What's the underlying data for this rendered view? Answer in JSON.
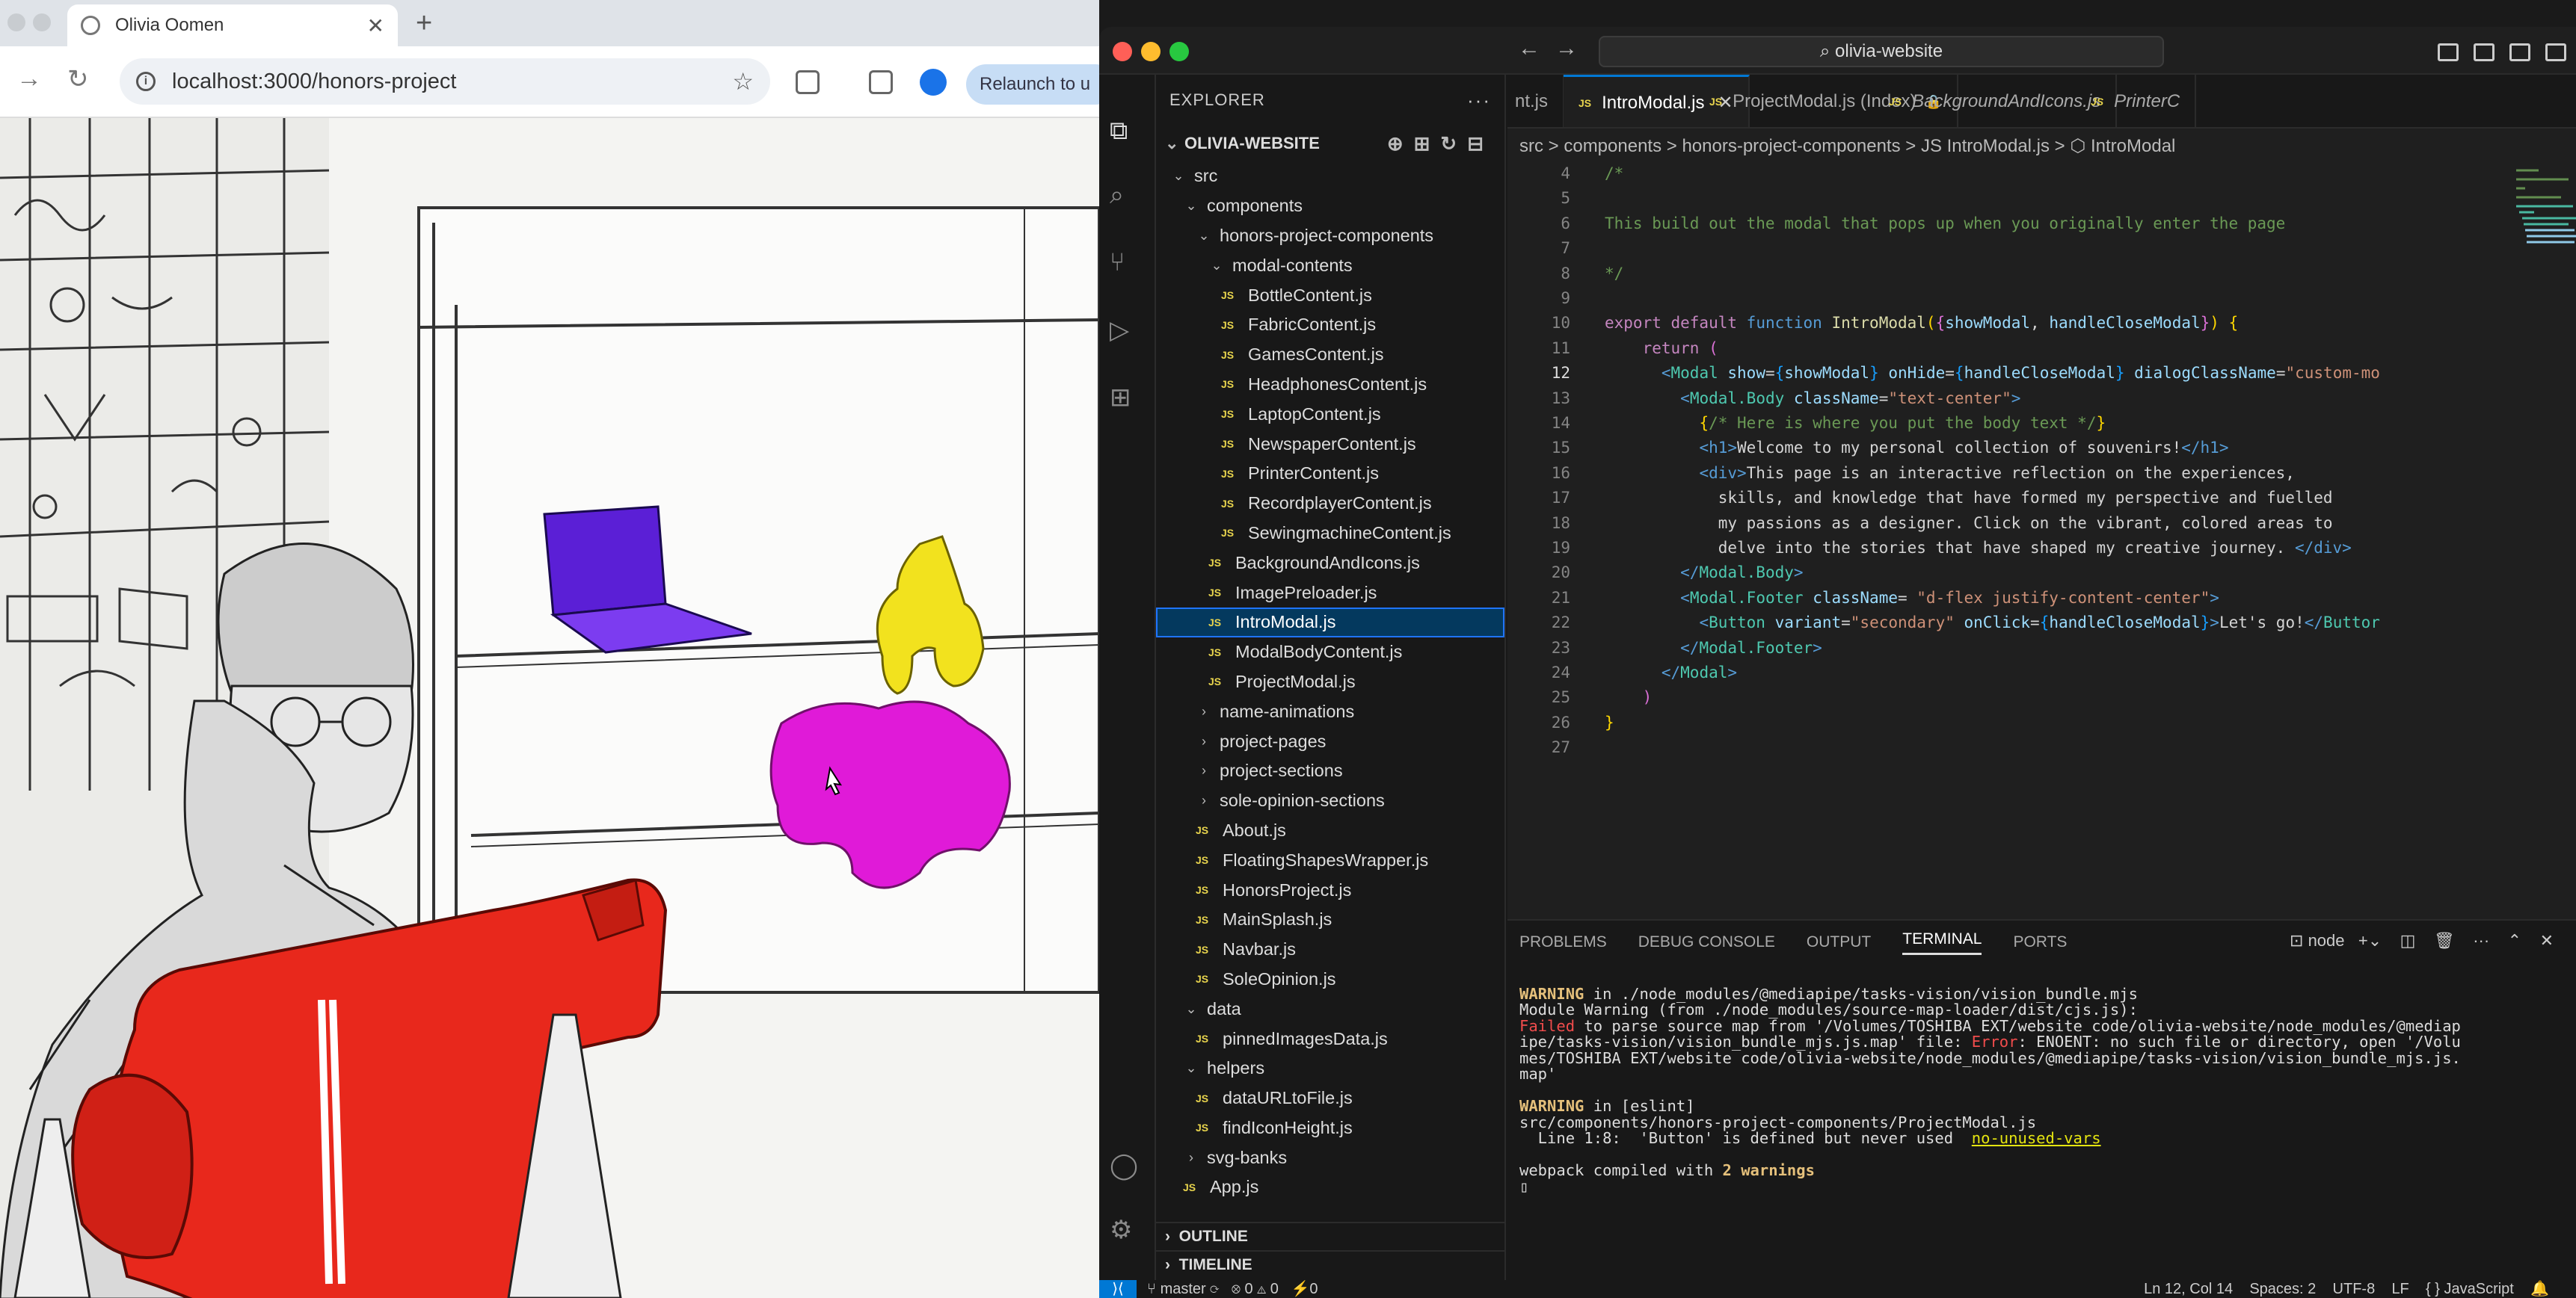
{
  "browser": {
    "tab_title": "Olivia Oomen",
    "url": "localhost:3000/honors-project",
    "relaunch_label": "Relaunch to u"
  },
  "vscode": {
    "command_center": "olivia-website",
    "explorer_title": "EXPLORER",
    "project_name": "OLIVIA-WEBSITE",
    "tree": [
      {
        "label": "src",
        "kind": "folder-open",
        "depth": 1
      },
      {
        "label": "components",
        "kind": "folder-open",
        "depth": 2
      },
      {
        "label": "honors-project-components",
        "kind": "folder-open",
        "depth": 3
      },
      {
        "label": "modal-contents",
        "kind": "folder-open",
        "depth": 4
      },
      {
        "label": "BottleContent.js",
        "kind": "js",
        "depth": 5
      },
      {
        "label": "FabricContent.js",
        "kind": "js",
        "depth": 5
      },
      {
        "label": "GamesContent.js",
        "kind": "js",
        "depth": 5
      },
      {
        "label": "HeadphonesContent.js",
        "kind": "js",
        "depth": 5
      },
      {
        "label": "LaptopContent.js",
        "kind": "js",
        "depth": 5
      },
      {
        "label": "NewspaperContent.js",
        "kind": "js",
        "depth": 5
      },
      {
        "label": "PrinterContent.js",
        "kind": "js",
        "depth": 5
      },
      {
        "label": "RecordplayerContent.js",
        "kind": "js",
        "depth": 5
      },
      {
        "label": "SewingmachineContent.js",
        "kind": "js",
        "depth": 5
      },
      {
        "label": "BackgroundAndIcons.js",
        "kind": "js",
        "depth": 4
      },
      {
        "label": "ImagePreloader.js",
        "kind": "js",
        "depth": 4
      },
      {
        "label": "IntroModal.js",
        "kind": "js",
        "depth": 4,
        "selected": true
      },
      {
        "label": "ModalBodyContent.js",
        "kind": "js",
        "depth": 4
      },
      {
        "label": "ProjectModal.js",
        "kind": "js",
        "depth": 4
      },
      {
        "label": "name-animations",
        "kind": "folder",
        "depth": 3
      },
      {
        "label": "project-pages",
        "kind": "folder",
        "depth": 3
      },
      {
        "label": "project-sections",
        "kind": "folder",
        "depth": 3
      },
      {
        "label": "sole-opinion-sections",
        "kind": "folder",
        "depth": 3
      },
      {
        "label": "About.js",
        "kind": "js",
        "depth": 3
      },
      {
        "label": "FloatingShapesWrapper.js",
        "kind": "js",
        "depth": 3
      },
      {
        "label": "HonorsProject.js",
        "kind": "js",
        "depth": 3
      },
      {
        "label": "MainSplash.js",
        "kind": "js",
        "depth": 3
      },
      {
        "label": "Navbar.js",
        "kind": "js",
        "depth": 3
      },
      {
        "label": "SoleOpinion.js",
        "kind": "js",
        "depth": 3
      },
      {
        "label": "data",
        "kind": "folder-open",
        "depth": 2
      },
      {
        "label": "pinnedImagesData.js",
        "kind": "js",
        "depth": 3
      },
      {
        "label": "helpers",
        "kind": "folder-open",
        "depth": 2
      },
      {
        "label": "dataURLtoFile.js",
        "kind": "js",
        "depth": 3
      },
      {
        "label": "findIconHeight.js",
        "kind": "js",
        "depth": 3
      },
      {
        "label": "svg-banks",
        "kind": "folder",
        "depth": 2
      },
      {
        "label": "App.js",
        "kind": "js",
        "depth": 2
      }
    ],
    "outline_label": "OUTLINE",
    "timeline_label": "TIMELINE",
    "tabs": [
      {
        "label": "nt.js",
        "active": false,
        "icon": false
      },
      {
        "label": "IntroModal.js",
        "active": true,
        "icon": true,
        "close": "✕"
      },
      {
        "label": "ProjectModal.js (Index)",
        "active": false,
        "icon": true,
        "lock": true
      },
      {
        "label": "BackgroundAndIcons.js",
        "active": false,
        "icon": true,
        "italic": true
      },
      {
        "label": "PrinterC",
        "active": false,
        "icon": true,
        "italic": true
      }
    ],
    "breadcrumb": "src > components > honors-project-components > JS IntroModal.js > ⬡ IntroModal",
    "cursor_line": "12",
    "code_lines": [
      {
        "n": "4",
        "html": "<span class=\"cm\">/*</span>"
      },
      {
        "n": "5",
        "html": ""
      },
      {
        "n": "6",
        "html": "<span class=\"cm\">This build out the modal that pops up when you originally enter the page</span>"
      },
      {
        "n": "7",
        "html": ""
      },
      {
        "n": "8",
        "html": "<span class=\"cm\">*/</span>"
      },
      {
        "n": "9",
        "html": ""
      },
      {
        "n": "10",
        "html": "<span class=\"ctrl\">export default</span> <span class=\"kw\">function</span> <span class=\"fn\">IntroModal</span><span class=\"br1\">(</span><span class=\"br2\">{</span><span class=\"var\">showModal</span>, <span class=\"var\">handleCloseModal</span><span class=\"br2\">}</span><span class=\"br1\">)</span> <span class=\"br1\">{</span>"
      },
      {
        "n": "11",
        "html": "    <span class=\"ctrl\">return</span> <span class=\"br2\">(</span>"
      },
      {
        "n": "12",
        "html": "      <span class=\"htag\">&lt;</span><span class=\"tag\">Modal</span> <span class=\"var\">show</span>=<span class=\"br3\">{</span><span class=\"var\">showModal</span><span class=\"br3\">}</span> <span class=\"var\">onHide</span>=<span class=\"br3\">{</span><span class=\"var\">handleCloseModal</span><span class=\"br3\">}</span> <span class=\"var\">dialogClassName</span>=<span class=\"str\">\"custom-mo</span>"
      },
      {
        "n": "13",
        "html": "        <span class=\"htag\">&lt;</span><span class=\"tag\">Modal.Body</span> <span class=\"var\">className</span>=<span class=\"str\">\"text-center\"</span><span class=\"htag\">&gt;</span>"
      },
      {
        "n": "14",
        "html": "          <span class=\"br1\">{</span><span class=\"cm\">/* Here is where you put the body text */</span><span class=\"br1\">}</span>"
      },
      {
        "n": "15",
        "html": "          <span class=\"htag\">&lt;h1&gt;</span>Welcome to my personal collection of souvenirs!<span class=\"htag\">&lt;/h1&gt;</span>"
      },
      {
        "n": "16",
        "html": "          <span class=\"htag\">&lt;div&gt;</span>This page is an interactive reflection on the experiences,"
      },
      {
        "n": "17",
        "html": "            skills, and knowledge that have formed my perspective and fuelled"
      },
      {
        "n": "18",
        "html": "            my passions as a designer. Click on the vibrant, colored areas to"
      },
      {
        "n": "19",
        "html": "            delve into the stories that have shaped my creative journey. <span class=\"htag\">&lt;/div&gt;</span>"
      },
      {
        "n": "20",
        "html": "        <span class=\"htag\">&lt;/</span><span class=\"tag\">Modal.Body</span><span class=\"htag\">&gt;</span>"
      },
      {
        "n": "21",
        "html": "        <span class=\"htag\">&lt;</span><span class=\"tag\">Modal.Footer</span> <span class=\"var\">className</span>= <span class=\"str\">\"d-flex justify-content-center\"</span><span class=\"htag\">&gt;</span>"
      },
      {
        "n": "22",
        "html": "          <span class=\"htag\">&lt;</span><span class=\"tag\">Button</span> <span class=\"var\">variant</span>=<span class=\"str\">\"secondary\"</span> <span class=\"var\">onClick</span>=<span class=\"br3\">{</span><span class=\"var\">handleCloseModal</span><span class=\"br3\">}</span><span class=\"htag\">&gt;</span>Let's go!<span class=\"htag\">&lt;/</span><span class=\"tag\">Buttor</span>"
      },
      {
        "n": "23",
        "html": "        <span class=\"htag\">&lt;/</span><span class=\"tag\">Modal.Footer</span><span class=\"htag\">&gt;</span>"
      },
      {
        "n": "24",
        "html": "      <span class=\"htag\">&lt;/</span><span class=\"tag\">Modal</span><span class=\"htag\">&gt;</span>"
      },
      {
        "n": "25",
        "html": "    <span class=\"br2\">)</span>"
      },
      {
        "n": "26",
        "html": "<span class=\"br1\">}</span>"
      },
      {
        "n": "27",
        "html": ""
      }
    ],
    "panel_tabs": [
      "PROBLEMS",
      "DEBUG CONSOLE",
      "OUTPUT",
      "TERMINAL",
      "PORTS"
    ],
    "panel_active": "TERMINAL",
    "terminal_process": "node",
    "terminal": [
      {
        "html": ""
      },
      {
        "html": "<span class=\"warn\">WARNING</span> in ./node_modules/@mediapipe/tasks-vision/vision_bundle.mjs"
      },
      {
        "html": "Module Warning (from ./node_modules/source-map-loader/dist/cjs.js):"
      },
      {
        "html": "<span class=\"err\">Failed</span> to parse source map from '/Volumes/TOSHIBA EXT/website code/olivia-website/node_modules/@mediap"
      },
      {
        "html": "ipe/tasks-vision/vision_bundle_mjs.js.map' file: <span class=\"err\">Error</span>: ENOENT: no such file or directory, open '/Volu"
      },
      {
        "html": "mes/TOSHIBA EXT/website code/olivia-website/node_modules/@mediapipe/tasks-vision/vision_bundle_mjs.js."
      },
      {
        "html": "map'"
      },
      {
        "html": ""
      },
      {
        "html": "<span class=\"warn\">WARNING</span> in [eslint]"
      },
      {
        "html": "src/components/honors-project-components/ProjectModal.js"
      },
      {
        "html": "  Line 1:8:  'Button' is defined but never used  <span class=\"yl\">no-unused-vars</span>"
      },
      {
        "html": ""
      },
      {
        "html": "webpack compiled with <span class=\"warn\">2 warnings</span>"
      },
      {
        "html": "▯"
      }
    ],
    "status": {
      "branch": "master",
      "sync": "⟳",
      "problems": "⊗ 0 ⚠ 0",
      "ports": "⚡0",
      "position": "Ln 12, Col 14",
      "spaces": "Spaces: 2",
      "encoding": "UTF-8",
      "eol": "LF",
      "language": "{ } JavaScript"
    }
  },
  "colors": {
    "laptop": "#5b1fd6",
    "headphones": "#f2e21e",
    "fabric": "#e01ad8",
    "machine": "#e8281c",
    "vs_accent": "#0078d4"
  }
}
